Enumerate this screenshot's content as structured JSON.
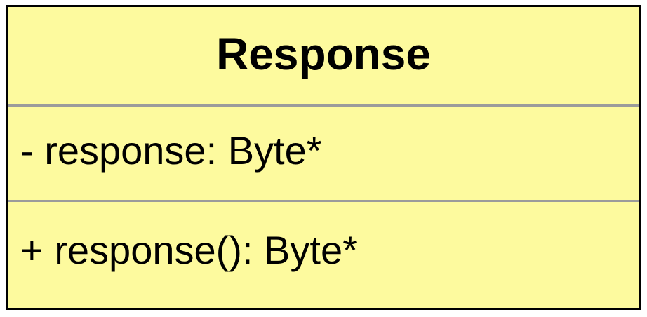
{
  "uml_class": {
    "name": "Response",
    "attributes": [
      {
        "text": "- response: Byte*"
      }
    ],
    "operations": [
      {
        "text": "+ response(): Byte*"
      }
    ]
  },
  "colors": {
    "fill": "#fdfa9e",
    "border": "#000000",
    "divider": "#9b9b9b",
    "text": "#000000"
  }
}
